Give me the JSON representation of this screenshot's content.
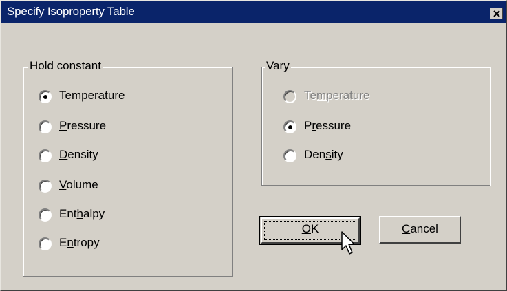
{
  "window": {
    "title": "Specify Isoproperty Table",
    "close_glyph": "×"
  },
  "hold_constant": {
    "legend": "Hold constant",
    "options": [
      {
        "label": "Temperature",
        "selected": true
      },
      {
        "label": "Pressure",
        "selected": false
      },
      {
        "label": "Density",
        "selected": false
      },
      {
        "label": "Volume",
        "selected": false
      },
      {
        "label": "Enthalpy",
        "selected": false
      },
      {
        "label": "Entropy",
        "selected": false
      }
    ]
  },
  "vary": {
    "legend": "Vary",
    "options": [
      {
        "label": "Temperature",
        "selected": false,
        "disabled": true
      },
      {
        "label": "Pressure",
        "selected": true,
        "disabled": false
      },
      {
        "label": "Density",
        "selected": false,
        "disabled": false
      }
    ]
  },
  "buttons": {
    "ok": "OK",
    "cancel": "Cancel"
  },
  "icons": {
    "close": "close-icon",
    "cursor": "mouse-pointer-icon"
  }
}
